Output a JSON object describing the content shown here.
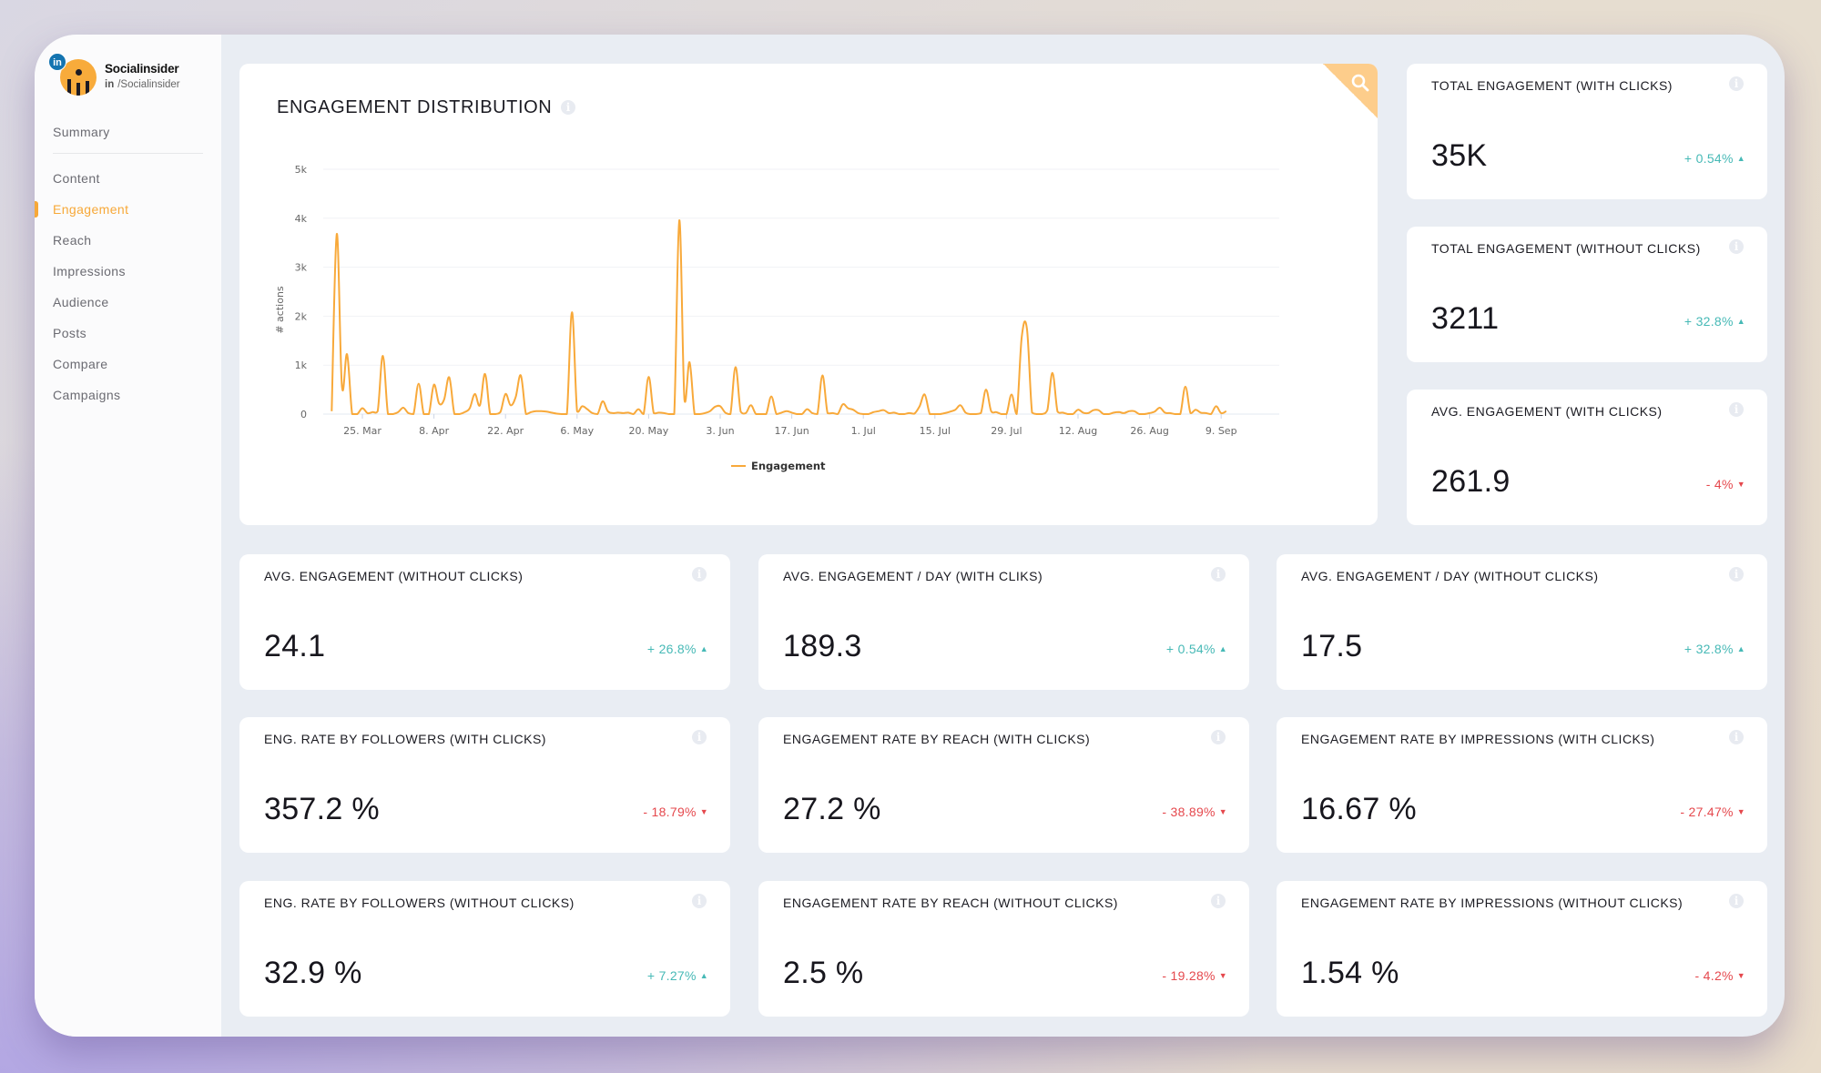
{
  "brand": {
    "name": "Socialinsider",
    "network_badge": "in",
    "handle_network": "in",
    "handle": "/Socialinsider"
  },
  "sidebar": {
    "items": [
      {
        "label": "Summary",
        "active": false
      },
      {
        "label": "Content",
        "active": false
      },
      {
        "label": "Engagement",
        "active": true
      },
      {
        "label": "Reach",
        "active": false
      },
      {
        "label": "Impressions",
        "active": false
      },
      {
        "label": "Audience",
        "active": false
      },
      {
        "label": "Posts",
        "active": false
      },
      {
        "label": "Compare",
        "active": false
      },
      {
        "label": "Campaigns",
        "active": false
      }
    ]
  },
  "colors": {
    "accent": "#f7a838",
    "positive": "#46b9b6",
    "negative": "#e5484d",
    "line": "#f8a93a"
  },
  "chart_card": {
    "title": "ENGAGEMENT DISTRIBUTION",
    "info_icon": "i"
  },
  "chart_data": {
    "type": "line",
    "title": "ENGAGEMENT DISTRIBUTION",
    "xlabel": "",
    "ylabel": "# actions",
    "ylim": [
      0,
      5000
    ],
    "yticks": [
      0,
      1000,
      2000,
      3000,
      4000,
      5000
    ],
    "ytick_labels": [
      "0",
      "1k",
      "2k",
      "3k",
      "4k",
      "5k"
    ],
    "xlim_days": [
      -6,
      178
    ],
    "xticks": [
      {
        "day": 0,
        "label": "25. Mar"
      },
      {
        "day": 14,
        "label": "8. Apr"
      },
      {
        "day": 28,
        "label": "22. Apr"
      },
      {
        "day": 42,
        "label": "6. May"
      },
      {
        "day": 56,
        "label": "20. May"
      },
      {
        "day": 70,
        "label": "3. Jun"
      },
      {
        "day": 84,
        "label": "17. Jun"
      },
      {
        "day": 98,
        "label": "1. Jul"
      },
      {
        "day": 112,
        "label": "15. Jul"
      },
      {
        "day": 126,
        "label": "29. Jul"
      },
      {
        "day": 140,
        "label": "12. Aug"
      },
      {
        "day": 154,
        "label": "26. Aug"
      },
      {
        "day": 168,
        "label": "9. Sep"
      }
    ],
    "grid": true,
    "legend": "bottom-center",
    "series": [
      {
        "name": "Engagement",
        "points": [
          [
            -6,
            60
          ],
          [
            -5,
            3680
          ],
          [
            -4,
            580
          ],
          [
            -3,
            1220
          ],
          [
            -2,
            0
          ],
          [
            -1,
            0
          ],
          [
            0,
            120
          ],
          [
            1,
            20
          ],
          [
            2,
            40
          ],
          [
            3,
            60
          ],
          [
            4,
            1190
          ],
          [
            5,
            0
          ],
          [
            6,
            0
          ],
          [
            7,
            40
          ],
          [
            8,
            130
          ],
          [
            9,
            20
          ],
          [
            10,
            0
          ],
          [
            11,
            620
          ],
          [
            12,
            0
          ],
          [
            13,
            0
          ],
          [
            14,
            600
          ],
          [
            15,
            220
          ],
          [
            16,
            300
          ],
          [
            17,
            750
          ],
          [
            18,
            0
          ],
          [
            19,
            0
          ],
          [
            20,
            40
          ],
          [
            21,
            120
          ],
          [
            22,
            410
          ],
          [
            23,
            180
          ],
          [
            24,
            820
          ],
          [
            25,
            0
          ],
          [
            26,
            0
          ],
          [
            27,
            40
          ],
          [
            28,
            410
          ],
          [
            29,
            180
          ],
          [
            30,
            350
          ],
          [
            31,
            790
          ],
          [
            32,
            0
          ],
          [
            33,
            40
          ],
          [
            34,
            60
          ],
          [
            35,
            60
          ],
          [
            36,
            50
          ],
          [
            37,
            30
          ],
          [
            38,
            10
          ],
          [
            39,
            0
          ],
          [
            40,
            0
          ],
          [
            41,
            2080
          ],
          [
            42,
            60
          ],
          [
            43,
            160
          ],
          [
            44,
            100
          ],
          [
            45,
            20
          ],
          [
            46,
            0
          ],
          [
            47,
            260
          ],
          [
            48,
            60
          ],
          [
            49,
            20
          ],
          [
            50,
            30
          ],
          [
            51,
            20
          ],
          [
            52,
            30
          ],
          [
            53,
            0
          ],
          [
            54,
            100
          ],
          [
            55,
            0
          ],
          [
            56,
            760
          ],
          [
            57,
            20
          ],
          [
            58,
            30
          ],
          [
            59,
            20
          ],
          [
            60,
            0
          ],
          [
            61,
            0
          ],
          [
            62,
            3960
          ],
          [
            63,
            300
          ],
          [
            64,
            1060
          ],
          [
            65,
            0
          ],
          [
            66,
            0
          ],
          [
            67,
            20
          ],
          [
            68,
            60
          ],
          [
            69,
            150
          ],
          [
            70,
            160
          ],
          [
            71,
            30
          ],
          [
            72,
            0
          ],
          [
            73,
            960
          ],
          [
            74,
            50
          ],
          [
            75,
            20
          ],
          [
            76,
            180
          ],
          [
            77,
            0
          ],
          [
            78,
            0
          ],
          [
            79,
            0
          ],
          [
            80,
            360
          ],
          [
            81,
            0
          ],
          [
            82,
            30
          ],
          [
            83,
            60
          ],
          [
            84,
            30
          ],
          [
            85,
            0
          ],
          [
            86,
            0
          ],
          [
            87,
            100
          ],
          [
            88,
            20
          ],
          [
            89,
            0
          ],
          [
            90,
            790
          ],
          [
            91,
            20
          ],
          [
            92,
            20
          ],
          [
            93,
            0
          ],
          [
            94,
            200
          ],
          [
            95,
            120
          ],
          [
            96,
            90
          ],
          [
            97,
            20
          ],
          [
            98,
            0
          ],
          [
            99,
            0
          ],
          [
            100,
            40
          ],
          [
            101,
            60
          ],
          [
            102,
            80
          ],
          [
            103,
            20
          ],
          [
            104,
            30
          ],
          [
            105,
            0
          ],
          [
            106,
            0
          ],
          [
            107,
            20
          ],
          [
            108,
            10
          ],
          [
            109,
            160
          ],
          [
            110,
            400
          ],
          [
            111,
            0
          ],
          [
            112,
            0
          ],
          [
            113,
            0
          ],
          [
            114,
            20
          ],
          [
            115,
            50
          ],
          [
            116,
            90
          ],
          [
            117,
            180
          ],
          [
            118,
            30
          ],
          [
            119,
            0
          ],
          [
            120,
            0
          ],
          [
            121,
            20
          ],
          [
            122,
            500
          ],
          [
            123,
            60
          ],
          [
            124,
            40
          ],
          [
            125,
            0
          ],
          [
            126,
            0
          ],
          [
            127,
            400
          ],
          [
            128,
            0
          ],
          [
            129,
            1580
          ],
          [
            130,
            1740
          ],
          [
            131,
            30
          ],
          [
            132,
            0
          ],
          [
            133,
            0
          ],
          [
            134,
            80
          ],
          [
            135,
            840
          ],
          [
            136,
            50
          ],
          [
            137,
            30
          ],
          [
            138,
            0
          ],
          [
            139,
            0
          ],
          [
            140,
            90
          ],
          [
            141,
            30
          ],
          [
            142,
            20
          ],
          [
            143,
            80
          ],
          [
            144,
            80
          ],
          [
            145,
            0
          ],
          [
            146,
            0
          ],
          [
            147,
            30
          ],
          [
            148,
            40
          ],
          [
            149,
            20
          ],
          [
            150,
            60
          ],
          [
            151,
            60
          ],
          [
            152,
            0
          ],
          [
            153,
            0
          ],
          [
            154,
            20
          ],
          [
            155,
            50
          ],
          [
            156,
            130
          ],
          [
            157,
            30
          ],
          [
            158,
            20
          ],
          [
            159,
            0
          ],
          [
            160,
            0
          ],
          [
            161,
            560
          ],
          [
            162,
            20
          ],
          [
            163,
            90
          ],
          [
            164,
            30
          ],
          [
            165,
            20
          ],
          [
            166,
            0
          ],
          [
            167,
            160
          ],
          [
            168,
            20
          ],
          [
            169,
            60
          ]
        ]
      }
    ]
  },
  "top_right_cards": [
    {
      "label": "TOTAL ENGAGEMENT (WITH CLICKS)",
      "value": "35K",
      "delta": "+ 0.54%",
      "trend": "up"
    },
    {
      "label": "TOTAL ENGAGEMENT (WITHOUT CLICKS)",
      "value": "3211",
      "delta": "+ 32.8%",
      "trend": "up"
    },
    {
      "label": "AVG. ENGAGEMENT (WITH CLICKS)",
      "value": "261.9",
      "delta": "- 4%",
      "trend": "down"
    }
  ],
  "grid_cards": [
    {
      "label": "AVG. ENGAGEMENT (WITHOUT CLICKS)",
      "value": "24.1",
      "delta": "+ 26.8%",
      "trend": "up"
    },
    {
      "label": "AVG. ENGAGEMENT / DAY (WITH CLIKS)",
      "value": "189.3",
      "delta": "+ 0.54%",
      "trend": "up"
    },
    {
      "label": "AVG. ENGAGEMENT / DAY (WITHOUT CLICKS)",
      "value": "17.5",
      "delta": "+ 32.8%",
      "trend": "up"
    },
    {
      "label": "ENG. RATE BY FOLLOWERS (WITH CLICKS)",
      "value": "357.2 %",
      "delta": "- 18.79%",
      "trend": "down"
    },
    {
      "label": "ENGAGEMENT RATE BY REACH (WITH CLICKS)",
      "value": "27.2 %",
      "delta": "- 38.89%",
      "trend": "down"
    },
    {
      "label": "ENGAGEMENT RATE BY IMPRESSIONS (WITH CLICKS)",
      "value": "16.67 %",
      "delta": "- 27.47%",
      "trend": "down"
    },
    {
      "label": "ENG. RATE BY FOLLOWERS (WITHOUT CLICKS)",
      "value": "32.9 %",
      "delta": "+ 7.27%",
      "trend": "up"
    },
    {
      "label": "ENGAGEMENT RATE BY REACH (WITHOUT CLICKS)",
      "value": "2.5 %",
      "delta": "- 19.28%",
      "trend": "down"
    },
    {
      "label": "ENGAGEMENT RATE BY IMPRESSIONS (WITHOUT CLICKS)",
      "value": "1.54 %",
      "delta": "- 4.2%",
      "trend": "down"
    }
  ],
  "icons": {
    "info": "i",
    "up_arrow": "▲",
    "down_arrow": "▼",
    "search": "search-icon",
    "linkedin": "linkedin-icon"
  }
}
